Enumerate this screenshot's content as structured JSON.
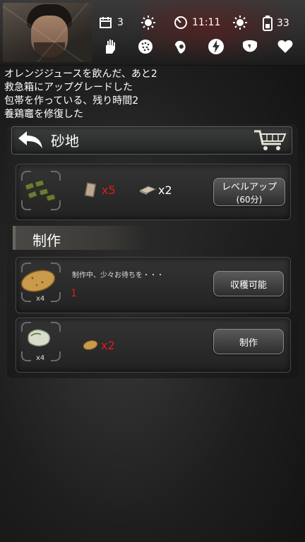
{
  "hud": {
    "days": "3",
    "time": "11:11",
    "battery": "33"
  },
  "log": [
    "オレンジジュースを飲んだ、あと2",
    "救急箱にアップグレードした",
    "包帯を作っている、残り時間2",
    "養鶏竈を修復した"
  ],
  "location": {
    "title": "砂地"
  },
  "upgrade": {
    "cost1": "x5",
    "cost2": "x2",
    "button_label": "レベルアップ",
    "button_sub": "(60分)"
  },
  "section": {
    "title": "制作"
  },
  "craft_items": [
    {
      "count": "x4",
      "status": "制作中、少々お待ちを・・・",
      "progress": "1",
      "button": "収穫可能"
    },
    {
      "count": "x4",
      "cost": "x2",
      "button": "制作"
    }
  ],
  "colors": {
    "accent_red": "#e01c1c"
  }
}
